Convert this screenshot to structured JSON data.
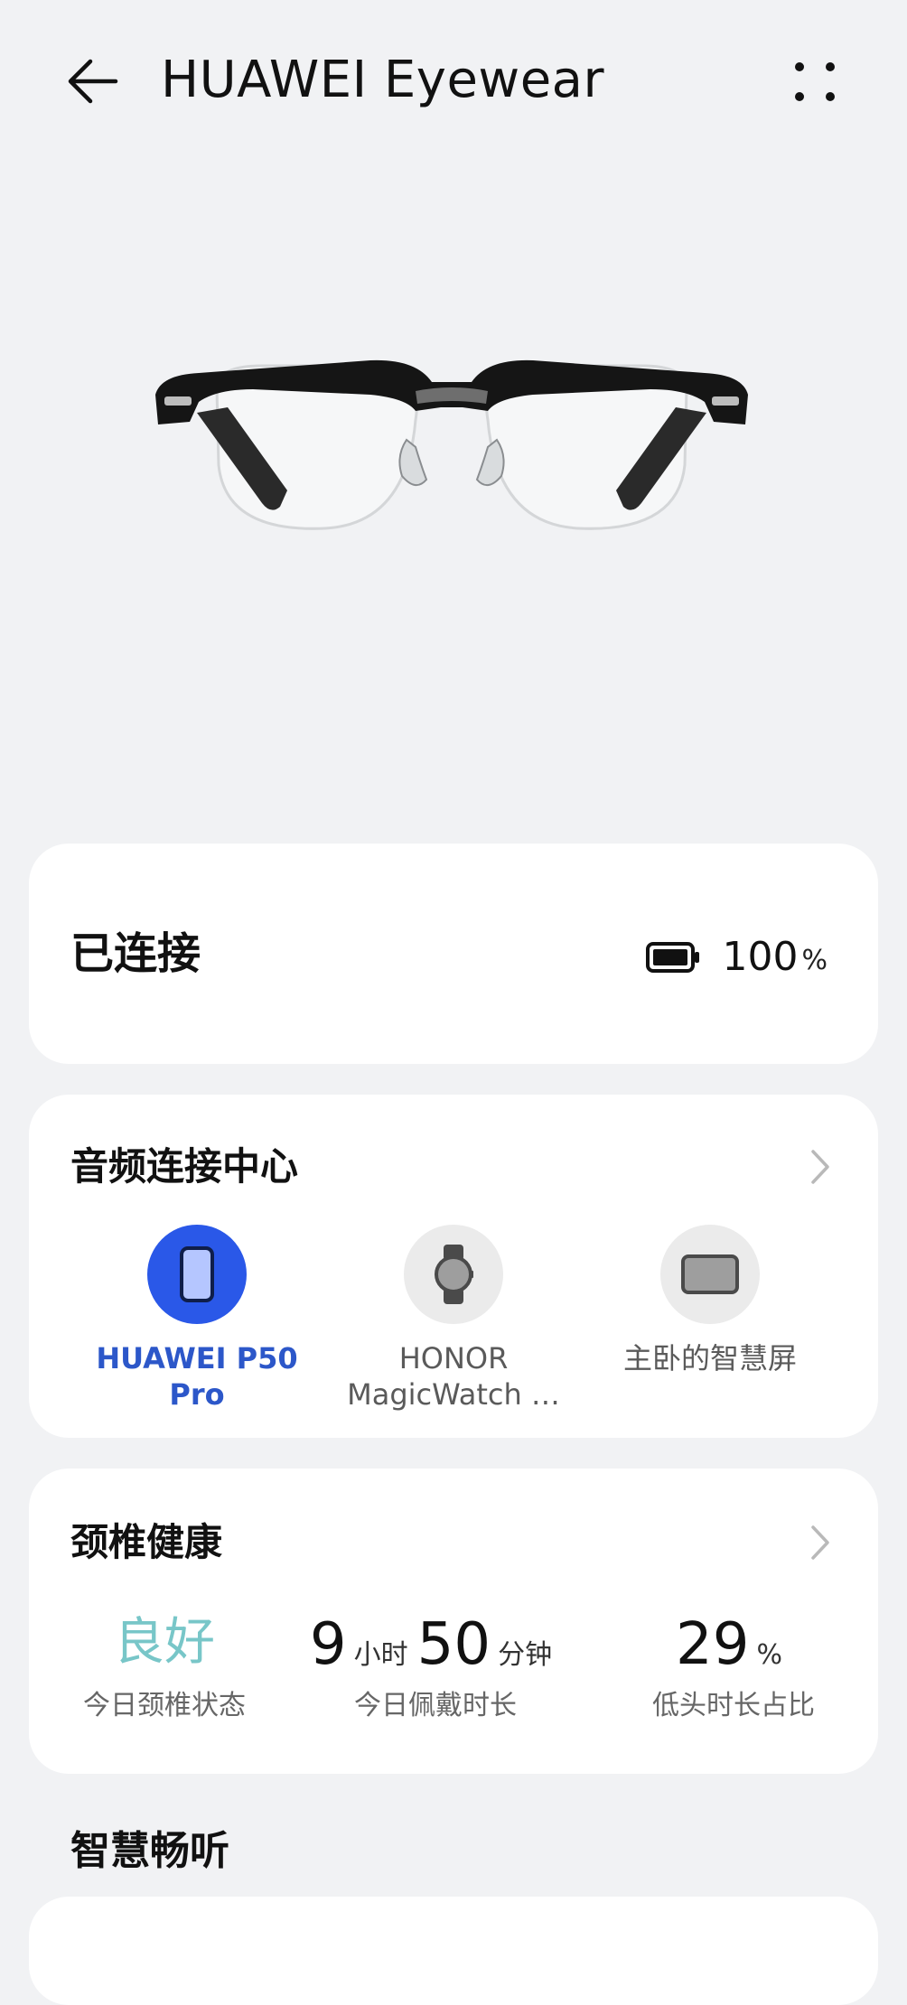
{
  "header": {
    "title": "HUAWEI Eyewear",
    "back_icon": "arrow-left-icon",
    "more_icon": "more-dots-icon"
  },
  "connection": {
    "status": "已连接",
    "battery_value": "100",
    "battery_unit": "%"
  },
  "audio_center": {
    "title": "音频连接中心",
    "devices": [
      {
        "label": "HUAWEI P50 Pro",
        "line1": "HUAWEI P50",
        "line2": "Pro",
        "icon": "phone-icon",
        "active": true
      },
      {
        "label": "HONOR MagicWatch …",
        "line1": "HONOR",
        "line2": "MagicWatch …",
        "icon": "watch-icon",
        "active": false
      },
      {
        "label": "主卧的智慧屏",
        "line1": "主卧的智慧屏",
        "line2": "",
        "icon": "tv-icon",
        "active": false
      }
    ]
  },
  "neck_health": {
    "title": "颈椎健康",
    "status_value": "良好",
    "status_label": "今日颈椎状态",
    "wear_hours": "9",
    "wear_hours_unit": "小时",
    "wear_minutes": "50",
    "wear_minutes_unit": "分钟",
    "wear_label": "今日佩戴时长",
    "head_down_value": "29",
    "head_down_unit": "%",
    "head_down_label": "低头时长占比"
  },
  "smart_listen": {
    "title": "智慧畅听"
  },
  "colors": {
    "accent": "#2a58e8",
    "good": "#78c6c8",
    "background": "#f1f2f4"
  }
}
